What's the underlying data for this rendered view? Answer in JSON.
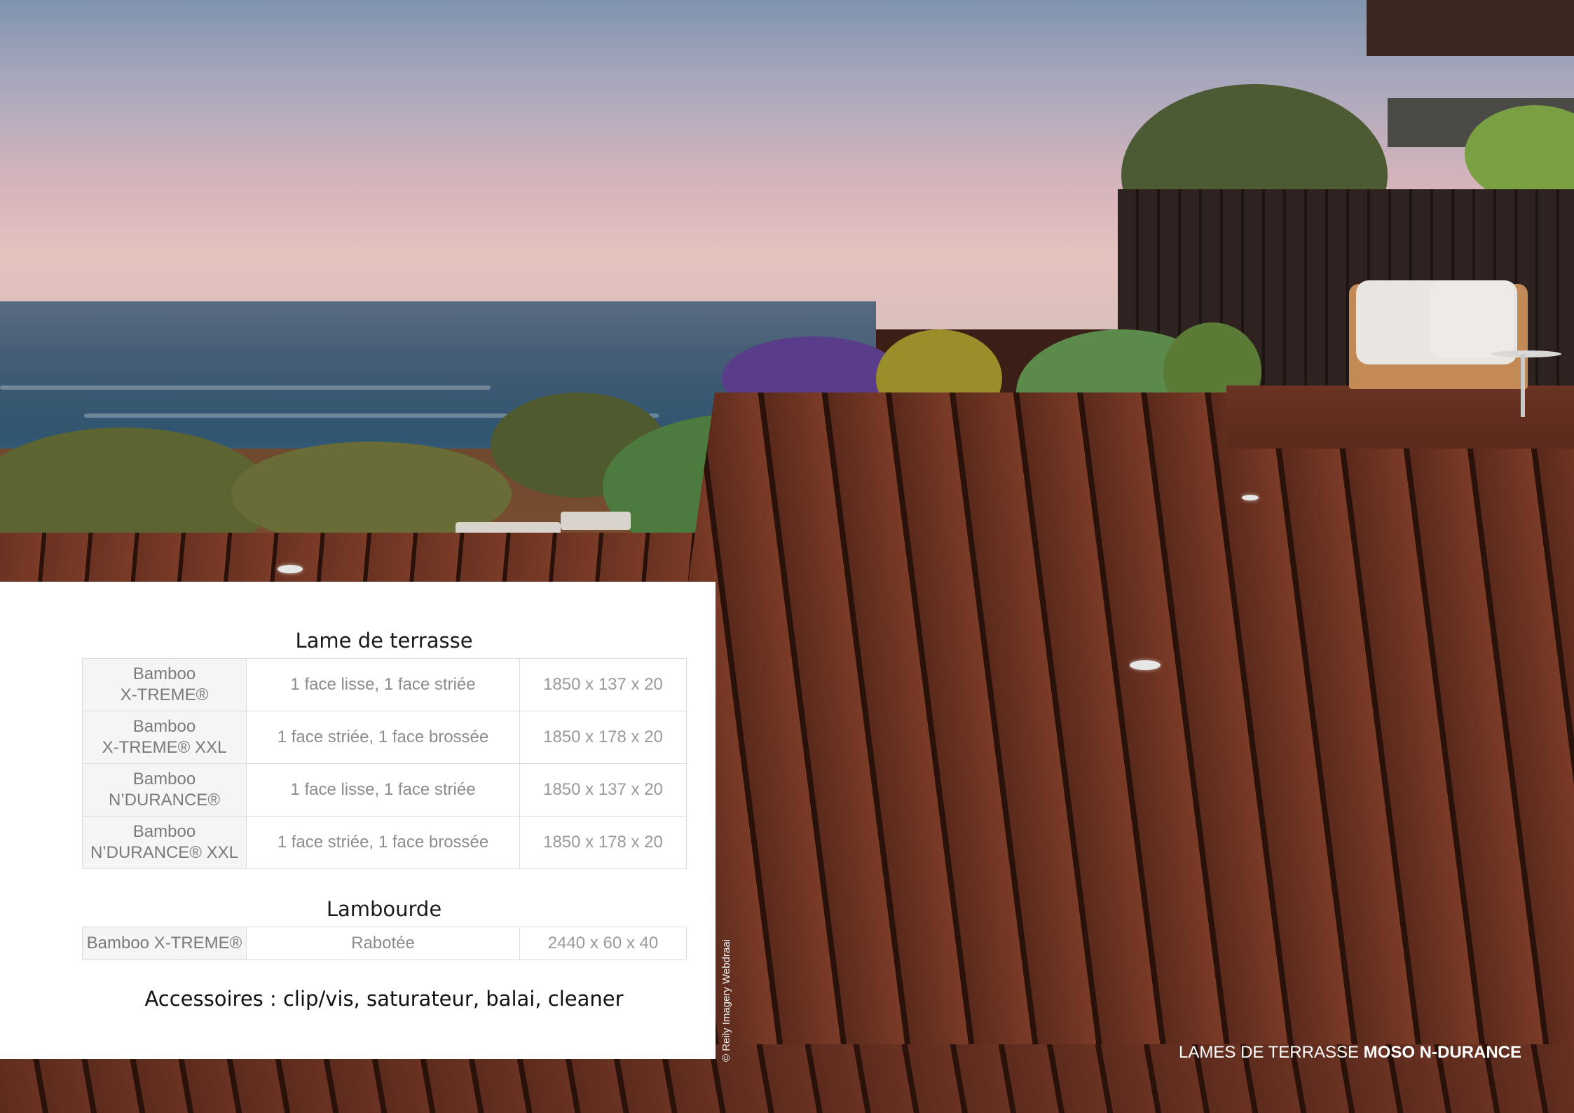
{
  "section_boards": {
    "title": "Lame de terrasse",
    "rows": [
      {
        "name_line1": "Bamboo",
        "name_line2": "X-TREME®",
        "finish": "1 face lisse, 1 face striée",
        "dimensions": "1850 x 137 x 20"
      },
      {
        "name_line1": "Bamboo",
        "name_line2": "X-TREME®  XXL",
        "finish": "1 face striée, 1 face brossée",
        "dimensions": "1850 x 178 x 20"
      },
      {
        "name_line1": "Bamboo",
        "name_line2": "N’DURANCE®",
        "finish": "1 face lisse, 1 face striée",
        "dimensions": "1850 x 137 x 20"
      },
      {
        "name_line1": "Bamboo",
        "name_line2": "N’DURANCE®  XXL",
        "finish": "1 face striée, 1 face brossée",
        "dimensions": "1850 x 178 x 20"
      }
    ]
  },
  "section_joists": {
    "title": "Lambourde",
    "rows": [
      {
        "name": "Bamboo X-TREME®",
        "finish": "Rabotée",
        "dimensions": "2440 x 60 x 40"
      }
    ]
  },
  "accessories": "Accessoires : clip/vis, saturateur, balai, cleaner",
  "photo_credit": "© Reily Imagery Webdraai",
  "footer": {
    "caption_regular": "LAMES DE TERRASSE",
    "caption_bold": "MOSO N-DURANCE"
  },
  "colors": {
    "panel_background": "#ffffff",
    "table_border": "#dcdcd8",
    "table_text": "#8c8c8c",
    "deck_wood": "#6b3221"
  }
}
